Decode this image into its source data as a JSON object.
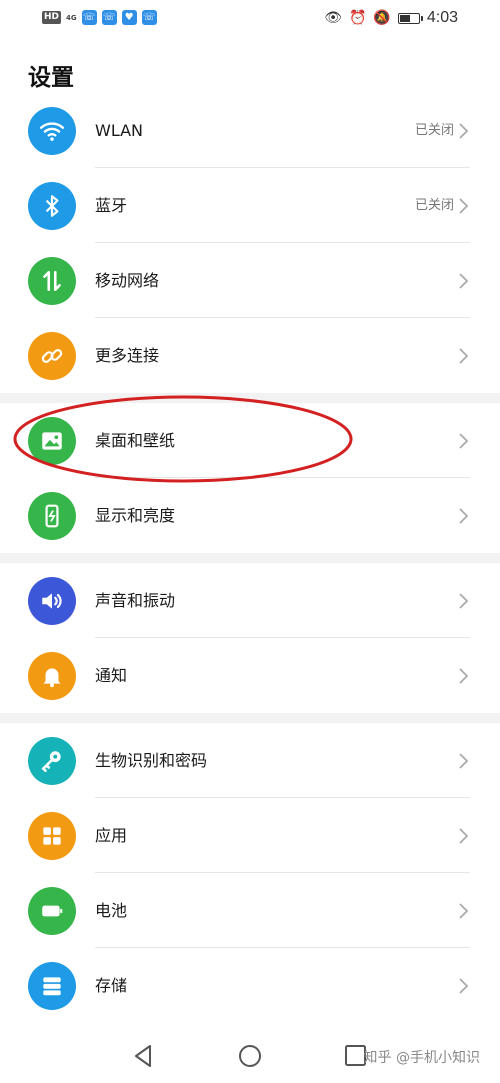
{
  "status_bar": {
    "hd": "HD",
    "net": "4G",
    "time": "4:03",
    "battery_level": 0.6
  },
  "page": {
    "title": "设置"
  },
  "items": [
    {
      "label": "WLAN",
      "status": "已关闭",
      "icon": "wifi-icon",
      "color": "#1e9ae6"
    },
    {
      "label": "蓝牙",
      "status": "已关闭",
      "icon": "bluetooth-icon",
      "color": "#1e9ae6"
    },
    {
      "label": "移动网络",
      "status": "",
      "icon": "mobile-network-icon",
      "color": "#36b54a"
    },
    {
      "label": "更多连接",
      "status": "",
      "icon": "link-icon",
      "color": "#f29a12"
    },
    {
      "label": "桌面和壁纸",
      "status": "",
      "icon": "wallpaper-icon",
      "color": "#36b54a"
    },
    {
      "label": "显示和亮度",
      "status": "",
      "icon": "display-icon",
      "color": "#36b54a"
    },
    {
      "label": "声音和振动",
      "status": "",
      "icon": "sound-icon",
      "color": "#3c58d8"
    },
    {
      "label": "通知",
      "status": "",
      "icon": "bell-icon",
      "color": "#f29a12"
    },
    {
      "label": "生物识别和密码",
      "status": "",
      "icon": "key-icon",
      "color": "#15b3b8"
    },
    {
      "label": "应用",
      "status": "",
      "icon": "apps-icon",
      "color": "#f29a12"
    },
    {
      "label": "电池",
      "status": "",
      "icon": "battery-icon",
      "color": "#36b54a"
    },
    {
      "label": "存储",
      "status": "",
      "icon": "storage-icon",
      "color": "#1e9ae6"
    }
  ],
  "watermark": "知乎 @手机小知识",
  "annotation_color": "#d32020"
}
